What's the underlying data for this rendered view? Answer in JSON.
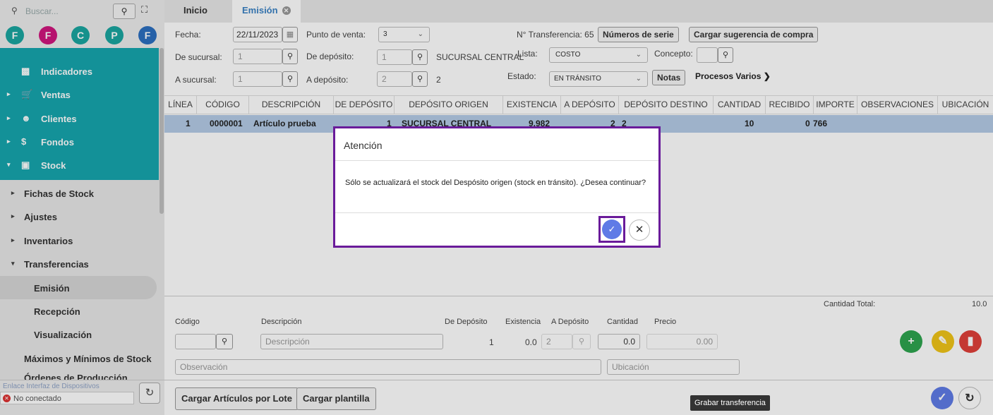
{
  "sidebar": {
    "search_placeholder": "Buscar...",
    "search_icon": "search-icon",
    "circles": [
      {
        "letter": "F",
        "color": "#1aa5a0"
      },
      {
        "letter": "F",
        "color": "#d0167e"
      },
      {
        "letter": "C",
        "color": "#1aa5a0"
      },
      {
        "letter": "P",
        "color": "#1aa5a0"
      },
      {
        "letter": "F",
        "color": "#2c6fc0"
      }
    ],
    "main_items": [
      {
        "label": "Indicadores",
        "icon": "dashboard-icon"
      },
      {
        "label": "Ventas",
        "icon": "cart-icon"
      },
      {
        "label": "Clientes",
        "icon": "people-icon"
      },
      {
        "label": "Fondos",
        "icon": "dollar-icon"
      },
      {
        "label": "Stock",
        "icon": "box-icon"
      }
    ],
    "sub_items": [
      "Fichas de Stock",
      "Ajustes",
      "Inventarios",
      "Transferencias",
      "Emisión",
      "Recepción",
      "Visualización",
      "Máximos y Mínimos de Stock",
      "Órdenes de Producción"
    ],
    "link_text": "Enlace Interfaz de Dispositivos",
    "status_text": "No conectado"
  },
  "tabs": [
    {
      "label": "Inicio"
    },
    {
      "label": "Emisión"
    }
  ],
  "form": {
    "fecha_label": "Fecha:",
    "fecha_value": "22/11/2023",
    "punto_venta_label": "Punto de venta:",
    "punto_venta_value": "3",
    "nro_transferencia_label": "N° Transferencia: 65",
    "numeros_serie_button": "Números de serie",
    "cargar_sugerencia_button": "Cargar sugerencia de compra",
    "de_sucursal_label": "De sucursal:",
    "de_sucursal_value": "1",
    "de_deposito_label": "De depósito:",
    "de_deposito_value": "1",
    "de_deposito_name": "SUCURSAL CENTRAL",
    "lista_label": "Lista:",
    "lista_value": "COSTO",
    "concepto_label": "Concepto:",
    "a_sucursal_label": "A sucursal:",
    "a_sucursal_value": "1",
    "a_deposito_label": "A depósito:",
    "a_deposito_value": "2",
    "a_deposito_name": "2",
    "estado_label": "Estado:",
    "estado_value": "EN TRÁNSITO",
    "notas_button": "Notas",
    "procesos_label": "Procesos Varios"
  },
  "table": {
    "columns": [
      "LÍNEA",
      "CÓDIGO",
      "DESCRIPCIÓN",
      "DE DEPÓSITO",
      "DEPÓSITO ORIGEN",
      "EXISTENCIA",
      "A DEPÓSITO",
      "DEPÓSITO DESTINO",
      "CANTIDAD",
      "RECIBIDO",
      "IMPORTE",
      "OBSERVACIONES",
      "UBICACIÓN"
    ],
    "row": {
      "linea": "1",
      "codigo": "0000001",
      "descripcion": "Artículo prueba",
      "de_deposito": "1",
      "deposito_origen": "SUCURSAL CENTRAL",
      "existencia": "9.982",
      "a_deposito": "2",
      "deposito_destino": "2",
      "cantidad": "10",
      "recibido": "0",
      "importe": "766"
    }
  },
  "footer": {
    "cantidad_total_label": "Cantidad Total:",
    "cantidad_total_value": "10.0",
    "codigo_label": "Código",
    "descripcion_label": "Descripción",
    "de_deposito_label": "De Depósito",
    "existencia_label": "Existencia",
    "a_deposito_label": "A Depósito",
    "cantidad_label": "Cantidad",
    "precio_label": "Precio",
    "descripcion_placeholder": "Descripción",
    "de_deposito_value": "1",
    "existencia_value": "0.0",
    "a_deposito_value": "2",
    "cantidad_value": "0.0",
    "precio_value": "0.00",
    "observacion_placeholder": "Observación",
    "ubicacion_placeholder": "Ubicación",
    "cargar_lote_button": "Cargar Artículos por Lote",
    "cargar_plantilla_button": "Cargar plantilla",
    "tooltip": "Grabar transferencia"
  },
  "modal": {
    "title": "Atención",
    "message": "Sólo se actualizará el stock del Despósito origen (stock en tránsito). ¿Desea continuar?"
  },
  "colors": {
    "teal": "#16a6ad",
    "selected_row": "#b4cbe6",
    "highlight": "#6a1b9a",
    "ok_button": "#5f7be6",
    "fab_add": "#2ea44f",
    "fab_edit": "#f0c419",
    "fab_delete": "#e0403a"
  }
}
